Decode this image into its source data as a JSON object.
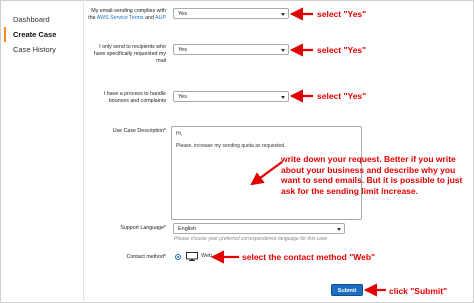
{
  "sidebar": {
    "items": [
      {
        "label": "Dashboard"
      },
      {
        "label": "Create Case"
      },
      {
        "label": "Case History"
      }
    ]
  },
  "form": {
    "compliance": {
      "label_prefix": "My email-sending complies with the ",
      "link1": "AWS Service Terms",
      "label_and": " and ",
      "link2": "AUP",
      "value": "Yes"
    },
    "only_send": {
      "label": "I only send to recipients who have specifically requested my mail",
      "value": "Yes"
    },
    "bounces": {
      "label": "I have a process to handle bounces and complaints",
      "value": "Yes"
    },
    "use_case": {
      "label": "Use Case Description*",
      "line1": "Hi,",
      "line2": "Please, increase my sending quota as requested."
    },
    "support_language": {
      "label": "Support Language*",
      "value": "English",
      "helper": "Please choose your preferred correspondence language for this case"
    },
    "contact_method": {
      "label": "Contact method*",
      "option": "Web"
    },
    "submit_label": "Submit"
  },
  "annotations": {
    "select_yes_1": "select \"Yes\"",
    "select_yes_2": "select \"Yes\"",
    "select_yes_3": "select \"Yes\"",
    "write_request": "write down your request. Better if you write about your business and describe why you want to send emails. But it is possible to just ask for the sending limit increase.",
    "select_web": "select the contact method \"Web\"",
    "click_submit": "click \"Submit\""
  },
  "colors": {
    "accent_red": "#e30000",
    "link_blue": "#1a6ec8",
    "submit_blue": "#1b6ec2",
    "active_orange": "#f08a24"
  }
}
